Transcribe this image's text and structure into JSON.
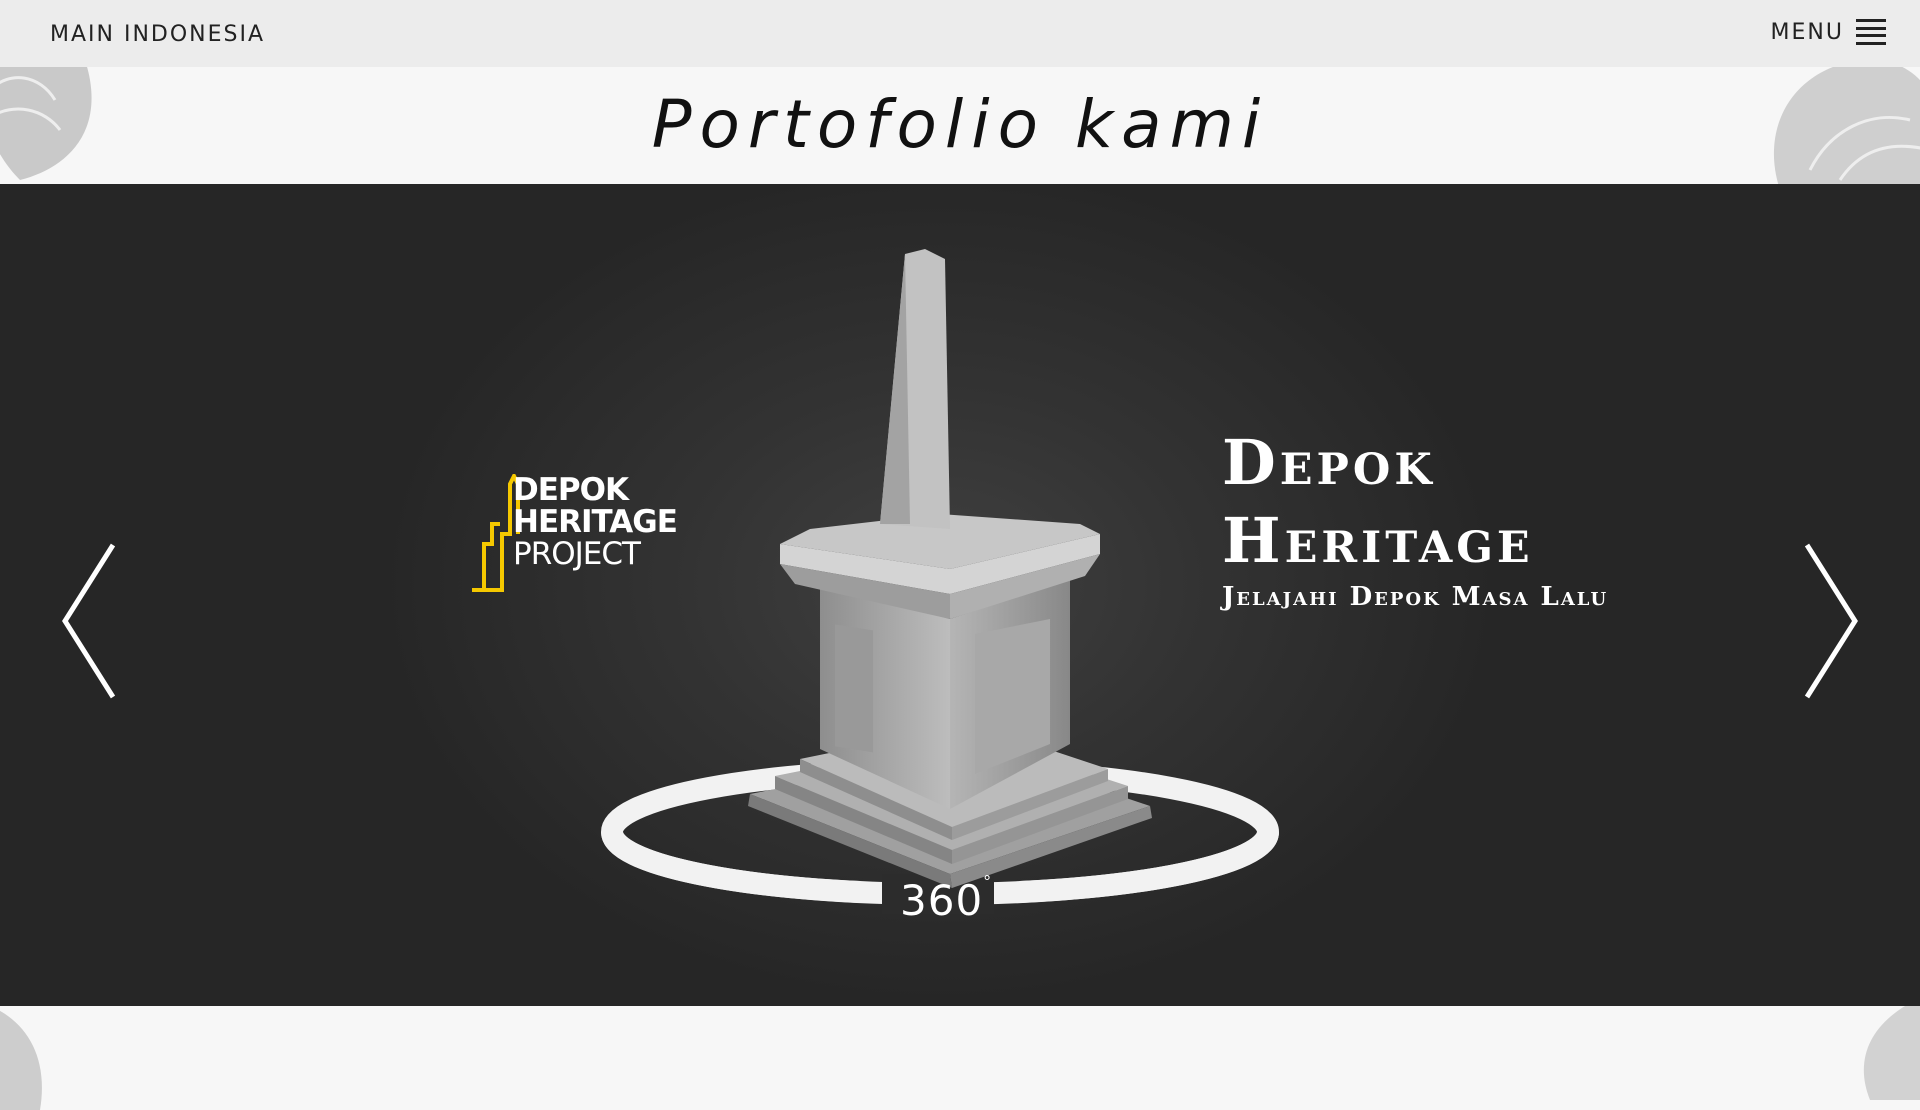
{
  "header": {
    "brand": "MAIN INDONESIA",
    "menu_label": "MENU",
    "menu_icon": "hamburger-icon"
  },
  "page_title": "Portofolio kami",
  "slider": {
    "prev_icon": "chevron-left-icon",
    "next_icon": "chevron-right-icon",
    "slide": {
      "logo": {
        "line1": "DEPOK",
        "line2": "HERITAGE",
        "line3": "PROJECT",
        "accent_color": "#f5c800"
      },
      "headline_line1": "Depok",
      "headline_line2": "Heritage",
      "tagline": "Jelajahi Depok Masa Lalu",
      "view_label": "360",
      "view_label_sup": "°"
    }
  },
  "colors": {
    "header_bg": "#ececec",
    "slider_bg": "#2b2b2b",
    "page_bg": "#f7f7f7"
  }
}
